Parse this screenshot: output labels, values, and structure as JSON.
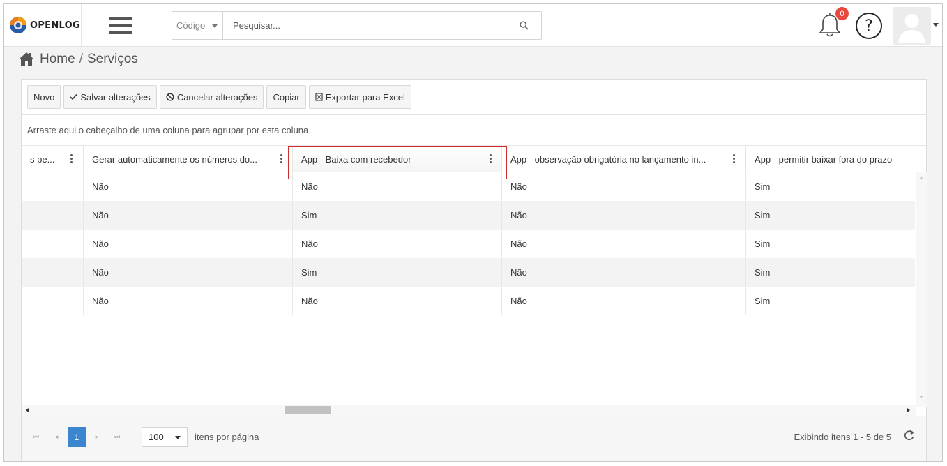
{
  "header": {
    "logo_text": "OPENLOG",
    "code_select": "Código",
    "search_placeholder": "Pesquisar...",
    "notification_count": "0",
    "help_label": "?"
  },
  "breadcrumb": {
    "home": "Home",
    "separator": "/",
    "current": "Serviços"
  },
  "toolbar": {
    "new": "Novo",
    "save": "Salvar alterações",
    "cancel": "Cancelar alterações",
    "copy": "Copiar",
    "export": "Exportar para Excel"
  },
  "grid": {
    "group_hint": "Arraste aqui o cabeçalho de uma coluna para agrupar por esta coluna",
    "columns": [
      "s pe...",
      "Gerar automaticamente os números do...",
      "App - Baixa com recebedor",
      "App - observação obrigatória no lançamento in...",
      "App - permitir baixar fora do prazo"
    ],
    "rows": [
      [
        "",
        "Não",
        "Não",
        "Não",
        "Sim"
      ],
      [
        "",
        "Não",
        "Sim",
        "Não",
        "Sim"
      ],
      [
        "",
        "Não",
        "Não",
        "Não",
        "Sim"
      ],
      [
        "",
        "Não",
        "Sim",
        "Não",
        "Sim"
      ],
      [
        "",
        "Não",
        "Não",
        "Não",
        "Sim"
      ]
    ]
  },
  "pager": {
    "current_page": "1",
    "page_size": "100",
    "page_size_label": "itens por página",
    "summary": "Exibindo itens 1 - 5 de 5"
  },
  "colors": {
    "accent": "#3b86cf",
    "badge": "#e8493e",
    "highlight_border": "#c9302c"
  }
}
